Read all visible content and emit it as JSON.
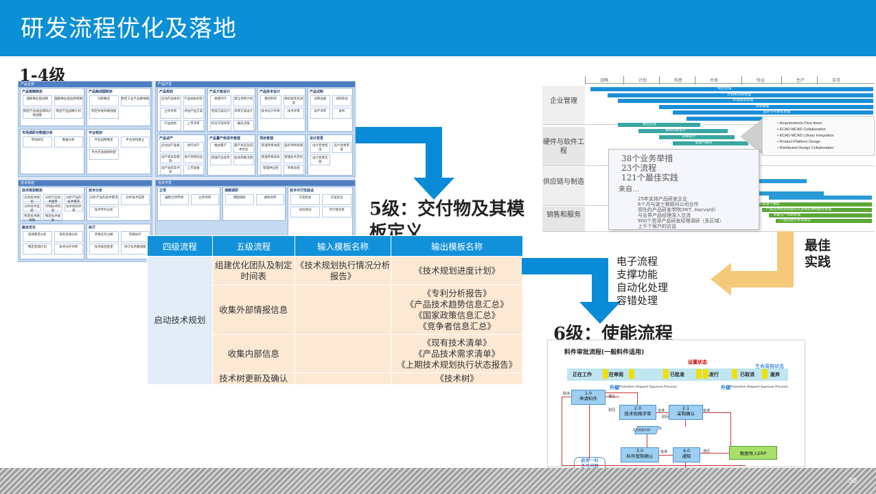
{
  "header": {
    "title": "研发流程优化及落地"
  },
  "labels": {
    "l14": "1-4级",
    "l5": "5级：交付物及其模板定义",
    "l6": "6级：使能流程",
    "best_practice": "最佳实践"
  },
  "enablers": [
    "电子流程",
    "支撑功能",
    "自动化处理",
    "容错处理"
  ],
  "page_number": "30",
  "mosaic": {
    "quadrants": [
      "产品企划",
      "产品开发",
      "技术规划",
      "技术开发"
    ],
    "blocks": [
      {
        "title": "产品策略制定",
        "cells": [
          "理解事业部战略",
          "理解事业部品牌策略",
          "制定产品线品牌和价格战略",
          "制定产品战略计划"
        ]
      },
      {
        "title": "产品路线图制定",
        "cells": [
          "创新概念",
          "制定工业产品路线图",
          "制定并发布路线图"
        ]
      },
      {
        "title": "市场调研与数据分析",
        "cells": [
          "市场研究",
          "数据分析"
        ]
      },
      {
        "title": "平台规划",
        "cells": [
          "平台战略制定",
          "平台架构建立",
          "平台开发规划制定"
        ]
      },
      {
        "title": "产品规划",
        "cells": [
          "启动产品规划",
          "产品规划初定",
          "立项评审",
          "评估产品方案",
          "产品规划",
          "上市评审"
        ]
      },
      {
        "title": "产品方案设计",
        "cells": [
          "组建PDT",
          "建立项目计划",
          "完成方案设计",
          "评审方案设计",
          "综合方案评审",
          "概念决策"
        ]
      },
      {
        "title": "产品技术设计",
        "cells": [
          "模具制作",
          "样机组装及测试",
          "技术设计评审",
          "技术评审"
        ]
      },
      {
        "title": "产品试制",
        "cells": [
          "试制准备",
          "试制验证",
          "试产评审",
          "发布"
        ]
      },
      {
        "title": "产品试产",
        "cells": [
          "启动试产准备",
          "进行试产",
          "试产测试及整改",
          "进行项目验证",
          "试产总结及评审",
          "上市准备"
        ]
      },
      {
        "title": "产品量产到退市管理",
        "cells": [
          "推进量产",
          "量产状态及成本优化",
          "管理产品退市",
          "生命周期决策"
        ]
      },
      {
        "title": "项目管理",
        "cells": [
          "管理项目进度",
          "监控项目质量",
          "管理项目成本",
          "管理技术风险",
          "管理供应链",
          "项目总结"
        ]
      },
      {
        "title": "设计变更",
        "cells": [
          "设计变更提出",
          "设计变更审核",
          "设计变更实施"
        ]
      },
      {
        "title": "技术规划制定",
        "cells": [
          "启动技术规划",
          "分析行业技术趋势",
          "分析产品的技术需求",
          "分析技术差距",
          "识别技术机会",
          "技术规划评审",
          "制定技术路线图",
          "制定技术规划"
        ]
      },
      {
        "title": "技术分析",
        "cells": [
          "分析产品的技术需求",
          "分析技术差距",
          "技术专利分析"
        ]
      },
      {
        "title": "融合优化",
        "cells": [
          "资源需求分析",
          "现有资源分析",
          "制定资源计划",
          "技术分析评审"
        ]
      },
      {
        "title": "执行",
        "cells": [
          "项目任务分解",
          "项目执行",
          "技术规划变更",
          "修订技术路线图"
        ]
      },
      {
        "title": "立项",
        "cells": [
          "编制立项申请",
          "立项评审"
        ]
      },
      {
        "title": "课题调研",
        "cells": [
          "课题调研",
          "调研评审"
        ]
      },
      {
        "title": "技术可行性验证",
        "cells": [
          "方案构思",
          "方案验证",
          "试验测试",
          "可行性评审"
        ]
      }
    ]
  },
  "table": {
    "headers": [
      "四级流程",
      "五级流程",
      "输入模板名称",
      "输出模板名称"
    ],
    "level4": "启动技术规划",
    "rows": [
      {
        "level5": "组建优化团队及制定时间表",
        "input": "《技术规划执行情况分析报告》",
        "output": [
          "《技术规划进度计划》"
        ]
      },
      {
        "level5": "收集外部情报信息",
        "input": "",
        "output": [
          "《专利分析报告》",
          "《产品技术趋势信息汇总》",
          "《国家政策信息汇总》",
          "《竞争者信息汇总》"
        ]
      },
      {
        "level5": "收集内部信息",
        "input": "",
        "output": [
          "《现有技术清单》",
          "《产品技术需求清单》",
          "《上期技术规划执行状态报告》"
        ]
      },
      {
        "level5": "技术树更新及确认",
        "input": "",
        "output": [
          "《技术树》"
        ]
      }
    ]
  },
  "best_practice_chart": {
    "phases": [
      "战略",
      "计划",
      "构思",
      "开发",
      "验证",
      "生产",
      "支持"
    ],
    "rows": [
      "企业管理",
      "硬件与软件工程",
      "供应链与制造",
      "销售和服务"
    ],
    "bars_top": [
      "组合管理",
      "计划和项目管理",
      "环境绩效管理",
      "法规遵循",
      "品质与可靠性管理",
      "变更与配置管理"
    ],
    "bars_hw": [
      "概念生成",
      "系统构架设计",
      "详细设计",
      "验证与确认"
    ],
    "bars_sales": [
      "产品的配置与销售",
      "产品支持信息的建议以及相关维修服务管理",
      "设备生产周期管理",
      "产品性能分析及报告"
    ],
    "callout": [
      "Requirements Flow down",
      "ECAD-MCAD Collaboration",
      "ECAD-MCAD Library Integration",
      "Product Platform Design",
      "Distributed Design Collaboration"
    ],
    "popup_big": [
      "38个业务举措",
      "23个流程",
      "121个最佳实践"
    ],
    "popup_sub": "来自…",
    "popup_small": [
      "25年支持产品研发企业",
      "6个月与波士顿顾问公司合作",
      "领先的产品研发学院(MIT, Harvard)",
      "与业界产品经理深入交流",
      "900个资深产品研发经理调研（多区域）",
      "上千个客户的访谈"
    ]
  },
  "workflow": {
    "title": "料件审批流程(一般料件适用)",
    "state_header": "设置状态",
    "lifecycle": "生命周期状态",
    "states": [
      "正在工作",
      "正在审阅",
      "已批准",
      "已发行",
      "已取消",
      "废弃"
    ],
    "upgrade": "升级",
    "upgrade_note": "(Promotion Request Approval Process)",
    "nodes": {
      "n1": "1.0\n申请料件",
      "n2": "2.0\n技术规格评审",
      "n21": "2.1\n采购确认",
      "n3": "3.0\n料件管制确认",
      "n4": "4.0\n通知",
      "n5": "5.0\n通知",
      "erp": "数据导入ERP",
      "avoid": "避免一料\n多号问题"
    },
    "edge_labels": {
      "approve": "批准",
      "reject": "驳回",
      "cancel": "取消",
      "pass": "通过",
      "n_label": "N",
      "check": "是否需要采购?"
    }
  }
}
